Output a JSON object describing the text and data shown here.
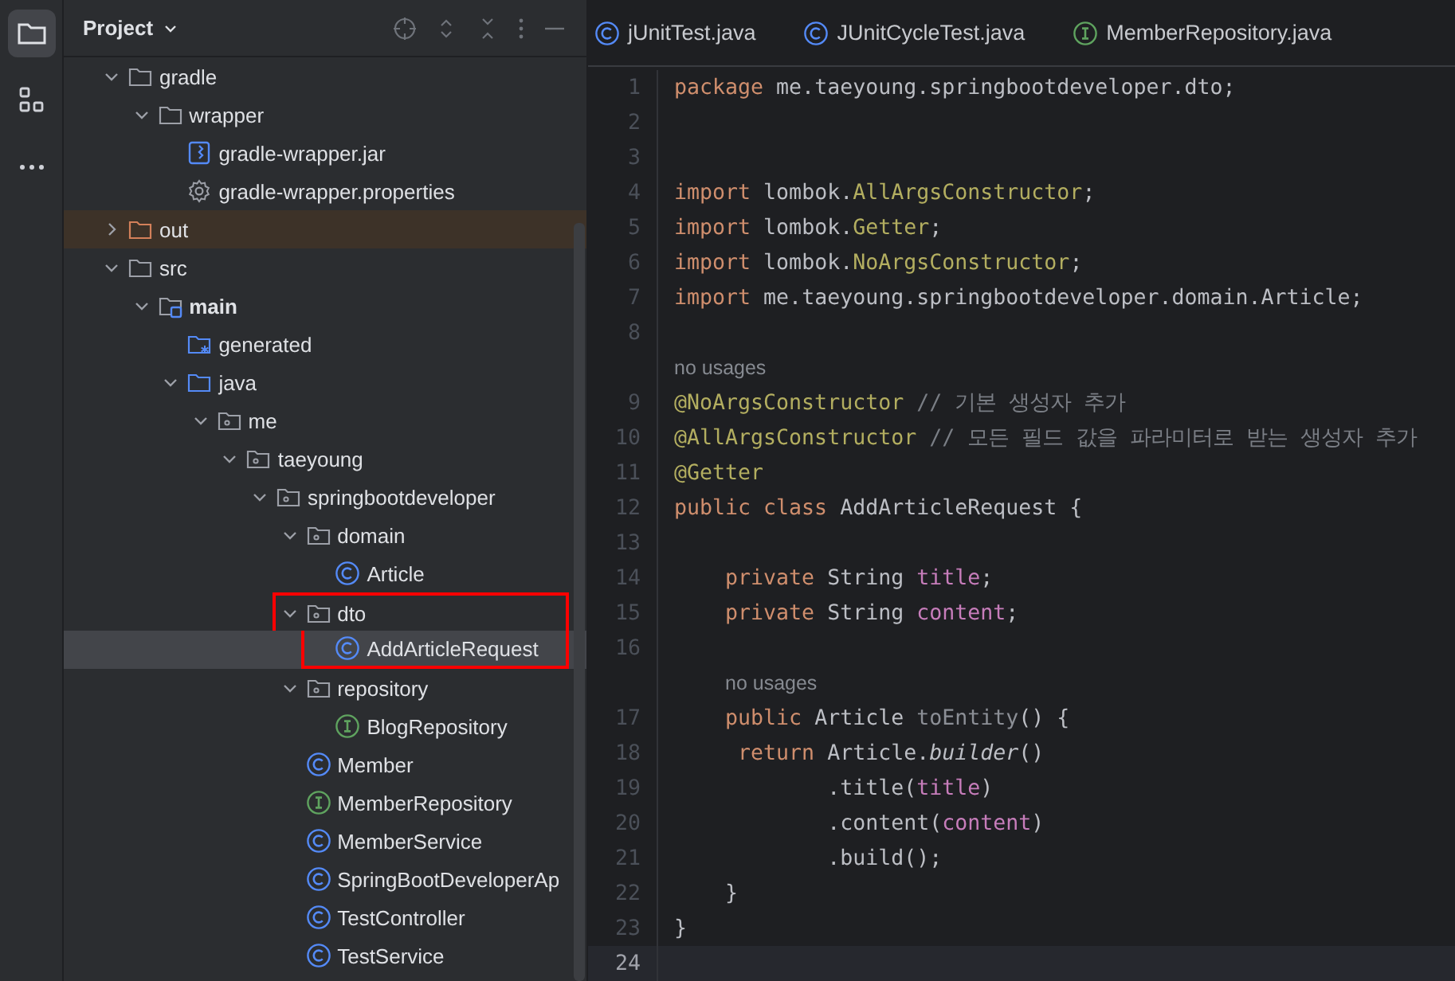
{
  "tool_strip": [
    {
      "kind": "project",
      "selected": true
    },
    {
      "kind": "structure",
      "selected": false
    },
    {
      "kind": "more",
      "selected": false
    }
  ],
  "project_panel": {
    "title": "Project",
    "tree": [
      {
        "label": "gradle",
        "kind": "folder",
        "expanded": true,
        "selected": false,
        "outlined": false,
        "children": [
          {
            "label": "wrapper",
            "kind": "folder",
            "expanded": true,
            "selected": false,
            "outlined": false,
            "children": [
              {
                "label": "gradle-wrapper.jar",
                "kind": "jar",
                "selected": false,
                "outlined": false
              },
              {
                "label": "gradle-wrapper.properties",
                "kind": "settings",
                "selected": false,
                "outlined": false
              }
            ]
          }
        ]
      },
      {
        "label": "out",
        "kind": "excluded-folder",
        "expanded": false,
        "selected": false,
        "outlined": false
      },
      {
        "label": "src",
        "kind": "folder",
        "expanded": true,
        "selected": false,
        "outlined": false,
        "children": [
          {
            "label": "main",
            "kind": "source-set",
            "expanded": true,
            "selected": false,
            "outlined": false,
            "children": [
              {
                "label": "generated",
                "kind": "generated-root",
                "selected": false,
                "outlined": false
              },
              {
                "label": "java",
                "kind": "source-root",
                "expanded": true,
                "selected": false,
                "outlined": false,
                "children": [
                  {
                    "label": "me",
                    "kind": "package",
                    "expanded": true,
                    "selected": false,
                    "outlined": false,
                    "children": [
                      {
                        "label": "taeyoung",
                        "kind": "package",
                        "expanded": true,
                        "selected": false,
                        "outlined": false,
                        "children": [
                          {
                            "label": "springbootdeveloper",
                            "kind": "package",
                            "expanded": true,
                            "selected": false,
                            "outlined": false,
                            "children": [
                              {
                                "label": "domain",
                                "kind": "package",
                                "expanded": true,
                                "selected": false,
                                "outlined": false,
                                "children": [
                                  {
                                    "label": "Article",
                                    "kind": "class",
                                    "selected": false,
                                    "outlined": false
                                  }
                                ]
                              },
                              {
                                "label": "dto",
                                "kind": "package",
                                "expanded": true,
                                "selected": false,
                                "outlined": true,
                                "children": [
                                  {
                                    "label": "AddArticleRequest",
                                    "kind": "class",
                                    "selected": true,
                                    "outlined": true
                                  }
                                ]
                              },
                              {
                                "label": "repository",
                                "kind": "package",
                                "expanded": true,
                                "selected": false,
                                "outlined": false,
                                "children": [
                                  {
                                    "label": "BlogRepository",
                                    "kind": "interface",
                                    "selected": false,
                                    "outlined": false
                                  }
                                ]
                              },
                              {
                                "label": "Member",
                                "kind": "class",
                                "selected": false,
                                "outlined": false
                              },
                              {
                                "label": "MemberRepository",
                                "kind": "interface",
                                "selected": false,
                                "outlined": false
                              },
                              {
                                "label": "MemberService",
                                "kind": "class",
                                "selected": false,
                                "outlined": false
                              },
                              {
                                "label": "SpringBootDeveloperAp",
                                "kind": "class",
                                "selected": false,
                                "outlined": false
                              },
                              {
                                "label": "TestController",
                                "kind": "class",
                                "selected": false,
                                "outlined": false
                              },
                              {
                                "label": "TestService",
                                "kind": "class",
                                "selected": false,
                                "outlined": false
                              }
                            ]
                          }
                        ]
                      }
                    ]
                  }
                ]
              }
            ]
          }
        ]
      }
    ]
  },
  "editor_tabs": [
    {
      "label": "jUnitTest.java",
      "kind": "class",
      "selected": false
    },
    {
      "label": "JUnitCycleTest.java",
      "kind": "class",
      "selected": false
    },
    {
      "label": "MemberRepository.java",
      "kind": "interface",
      "selected": false
    }
  ],
  "editor_lines": [
    {
      "kind": "code",
      "number": "1",
      "current": false,
      "tokens": [
        {
          "kind": "keyword",
          "text": "package "
        },
        {
          "kind": "plain",
          "text": "me.taeyoung.springbootdeveloper.dto;"
        }
      ]
    },
    {
      "kind": "code",
      "number": "2",
      "current": false
    },
    {
      "kind": "code",
      "number": "3",
      "current": false
    },
    {
      "kind": "code",
      "number": "4",
      "current": false,
      "tokens": [
        {
          "kind": "keyword",
          "text": "import "
        },
        {
          "kind": "plain",
          "text": "lombok."
        },
        {
          "kind": "annotation",
          "text": "AllArgsConstructor"
        },
        {
          "kind": "plain",
          "text": ";"
        }
      ]
    },
    {
      "kind": "code",
      "number": "5",
      "current": false,
      "tokens": [
        {
          "kind": "keyword",
          "text": "import "
        },
        {
          "kind": "plain",
          "text": "lombok."
        },
        {
          "kind": "annotation",
          "text": "Getter"
        },
        {
          "kind": "plain",
          "text": ";"
        }
      ]
    },
    {
      "kind": "code",
      "number": "6",
      "current": false,
      "tokens": [
        {
          "kind": "keyword",
          "text": "import "
        },
        {
          "kind": "plain",
          "text": "lombok."
        },
        {
          "kind": "annotation",
          "text": "NoArgsConstructor"
        },
        {
          "kind": "plain",
          "text": ";"
        }
      ]
    },
    {
      "kind": "code",
      "number": "7",
      "current": false,
      "tokens": [
        {
          "kind": "keyword",
          "text": "import "
        },
        {
          "kind": "plain",
          "text": "me.taeyoung.springbootdeveloper.domain.Article;"
        }
      ]
    },
    {
      "kind": "code",
      "number": "8",
      "current": false
    },
    {
      "kind": "hint",
      "tokens": [
        {
          "kind": "hint",
          "text": "no usages"
        }
      ]
    },
    {
      "kind": "code",
      "number": "9",
      "current": false,
      "tokens": [
        {
          "kind": "annotation",
          "text": "@NoArgsConstructor"
        },
        {
          "kind": "comment",
          "text": " // 기본 생성자 추가"
        }
      ]
    },
    {
      "kind": "code",
      "number": "10",
      "current": false,
      "tokens": [
        {
          "kind": "annotation",
          "text": "@AllArgsConstructor"
        },
        {
          "kind": "comment",
          "text": " // 모든 필드 값을 파라미터로 받는 생성자 추가"
        }
      ]
    },
    {
      "kind": "code",
      "number": "11",
      "current": false,
      "tokens": [
        {
          "kind": "annotation",
          "text": "@Getter"
        }
      ]
    },
    {
      "kind": "code",
      "number": "12",
      "current": false,
      "tokens": [
        {
          "kind": "keyword",
          "text": "public class "
        },
        {
          "kind": "plain",
          "text": "AddArticleRequest {"
        }
      ]
    },
    {
      "kind": "code",
      "number": "13",
      "current": false
    },
    {
      "kind": "code",
      "number": "14",
      "current": false,
      "tokens": [
        {
          "kind": "keyword",
          "text": "    private "
        },
        {
          "kind": "plain",
          "text": "String "
        },
        {
          "kind": "field",
          "text": "title"
        },
        {
          "kind": "plain",
          "text": ";"
        }
      ]
    },
    {
      "kind": "code",
      "number": "15",
      "current": false,
      "tokens": [
        {
          "kind": "keyword",
          "text": "    private "
        },
        {
          "kind": "plain",
          "text": "String "
        },
        {
          "kind": "field",
          "text": "content"
        },
        {
          "kind": "plain",
          "text": ";"
        }
      ]
    },
    {
      "kind": "code",
      "number": "16",
      "current": false
    },
    {
      "kind": "member-hint",
      "tokens": [
        {
          "kind": "hint",
          "text": "no usages"
        }
      ]
    },
    {
      "kind": "code",
      "number": "17",
      "current": false,
      "tokens": [
        {
          "kind": "keyword",
          "text": "    public "
        },
        {
          "kind": "plain",
          "text": "Article "
        },
        {
          "kind": "unused",
          "text": "toEntity"
        },
        {
          "kind": "plain",
          "text": "() {"
        }
      ]
    },
    {
      "kind": "code",
      "number": "18",
      "current": false,
      "tokens": [
        {
          "kind": "keyword",
          "text": "     return "
        },
        {
          "kind": "plain",
          "text": "Article."
        },
        {
          "kind": "static",
          "text": "builder"
        },
        {
          "kind": "plain",
          "text": "()"
        }
      ]
    },
    {
      "kind": "code",
      "number": "19",
      "current": false,
      "tokens": [
        {
          "kind": "plain",
          "text": "            .title("
        },
        {
          "kind": "field",
          "text": "title"
        },
        {
          "kind": "plain",
          "text": ")"
        }
      ]
    },
    {
      "kind": "code",
      "number": "20",
      "current": false,
      "tokens": [
        {
          "kind": "plain",
          "text": "            .content("
        },
        {
          "kind": "field",
          "text": "content"
        },
        {
          "kind": "plain",
          "text": ")"
        }
      ]
    },
    {
      "kind": "code",
      "number": "21",
      "current": false,
      "tokens": [
        {
          "kind": "plain",
          "text": "            .build();"
        }
      ]
    },
    {
      "kind": "code",
      "number": "22",
      "current": false,
      "tokens": [
        {
          "kind": "plain",
          "text": "    }"
        }
      ]
    },
    {
      "kind": "code",
      "number": "23",
      "current": false,
      "tokens": [
        {
          "kind": "plain",
          "text": "}"
        }
      ]
    },
    {
      "kind": "code",
      "number": "24",
      "current": true
    }
  ]
}
